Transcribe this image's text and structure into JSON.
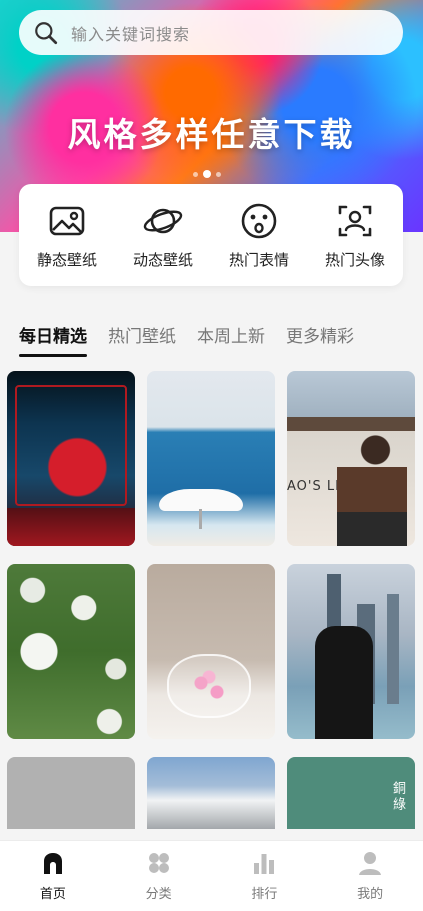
{
  "search": {
    "placeholder": "输入关键词搜索"
  },
  "banner": {
    "title": "风格多样任意下载",
    "active_dot": 2,
    "dot_count": 3
  },
  "quick_actions": [
    {
      "label": "静态壁纸",
      "icon": "image-icon"
    },
    {
      "label": "动态壁纸",
      "icon": "planet-icon"
    },
    {
      "label": "热门表情",
      "icon": "emoji-icon"
    },
    {
      "label": "热门头像",
      "icon": "avatar-icon"
    }
  ],
  "tabs": [
    {
      "label": "每日精选",
      "active": true
    },
    {
      "label": "热门壁纸",
      "active": false
    },
    {
      "label": "本周上新",
      "active": false
    },
    {
      "label": "更多精彩",
      "active": false
    }
  ],
  "gallery": {
    "tile3_sign": "AO'S LIFE",
    "tile9_text": "銅綠"
  },
  "tabbar": [
    {
      "label": "首页",
      "icon": "home-icon",
      "active": true
    },
    {
      "label": "分类",
      "icon": "category-icon",
      "active": false
    },
    {
      "label": "排行",
      "icon": "ranking-icon",
      "active": false
    },
    {
      "label": "我的",
      "icon": "profile-icon",
      "active": false
    }
  ],
  "colors": {
    "active": "#111111",
    "inactive": "#7a7a7a",
    "background": "#f4f4f4"
  }
}
